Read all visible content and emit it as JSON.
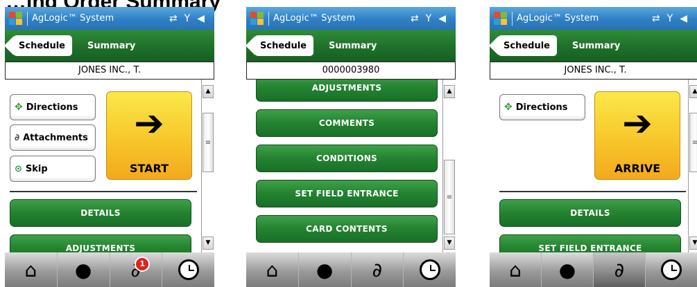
{
  "page_title": "…ing Order Summary",
  "screens": [
    {
      "status": {
        "app_title": "AgLogic™ System",
        "icons": [
          "sync-icon",
          "signal-icon",
          "volume-icon"
        ]
      },
      "nav": {
        "back_label": "Schedule",
        "title": "Summary"
      },
      "name_bar": "JONES INC., T.",
      "buttons": {
        "directions": "Directions",
        "attachments": "Attachments",
        "skip": "Skip"
      },
      "action": {
        "label": "START"
      },
      "green_buttons": [
        "DETAILS",
        "ADJUSTMENTS"
      ],
      "tabs": {
        "attachment_badge": "1"
      }
    },
    {
      "status": {
        "app_title": "AgLogic™ System"
      },
      "nav": {
        "back_label": "Schedule",
        "title": "Summary"
      },
      "name_bar": "0000003980",
      "green_buttons": [
        "ADJUSTMENTS",
        "COMMENTS",
        "CONDITIONS",
        "SET FIELD ENTRANCE",
        "CARD CONTENTS"
      ]
    },
    {
      "status": {
        "app_title": "AgLogic™ System"
      },
      "nav": {
        "back_label": "Schedule",
        "title": "Summary"
      },
      "name_bar": "JONES INC., T.",
      "buttons": {
        "directions": "Directions"
      },
      "action": {
        "label": "ARRIVE"
      },
      "green_buttons": [
        "DETAILS",
        "SET FIELD ENTRANCE"
      ]
    }
  ],
  "colors": {
    "status_blue": "#2f7fc4",
    "nav_green": "#1d6e28",
    "button_green": "#23822f",
    "action_yellow": "#f7c72a",
    "badge_red": "#dd2222"
  }
}
